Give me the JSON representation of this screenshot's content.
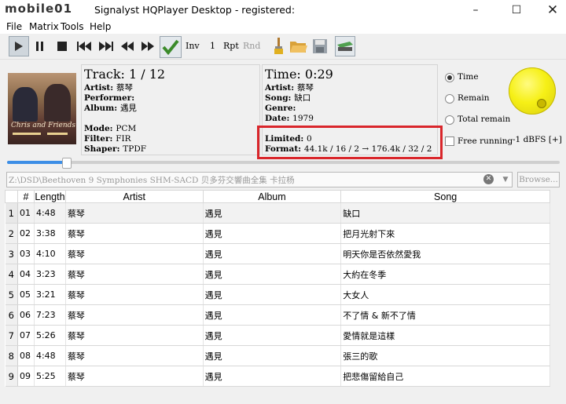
{
  "window": {
    "logo": "mobile01",
    "title": "Signalyst HQPlayer Desktop - registered:"
  },
  "menu": [
    "File",
    "Matrix",
    "Tools",
    "Help"
  ],
  "toolbar": {
    "inv": "Inv",
    "one": "1",
    "rpt": "Rpt",
    "rnd": "Rnd"
  },
  "album_art": {
    "caption": "Chris and Friends"
  },
  "track": {
    "header": "Track: 1 / 12",
    "artist_label": "Artist:",
    "artist": "蔡琴",
    "performer_label": "Performer:",
    "performer": "",
    "album_label": "Album:",
    "album": "遇見",
    "mode_label": "Mode:",
    "mode": "PCM",
    "filter_label": "Filter:",
    "filter": "FIR",
    "shaper_label": "Shaper:",
    "shaper": "TPDF"
  },
  "time": {
    "header": "Time: 0:29",
    "artist_label": "Artist:",
    "artist": "蔡琴",
    "song_label": "Song:",
    "song": "缺口",
    "genre_label": "Genre:",
    "genre": "",
    "date_label": "Date:",
    "date": "1979",
    "limited_label": "Limited:",
    "limited": "0",
    "format_label": "Format:",
    "format": "44.1k / 16 / 2 → 176.4k / 32 / 2"
  },
  "options": {
    "time": "Time",
    "remain": "Remain",
    "total_remain": "Total remain",
    "free_running": "Free running",
    "volume": "-1 dBFS [+]"
  },
  "accent": {
    "highlight": "#d9262b",
    "slider": "#3d8ee6",
    "knob": "#f6f016"
  },
  "path": "Z:\\DSD\\Beethoven 9 Symphonies SHM-SACD 贝多芬交響曲全集 卡拉杨",
  "browse": "Browse...",
  "playlist": {
    "headers": [
      "#",
      "Length",
      "Artist",
      "Album",
      "Song"
    ],
    "rows": [
      {
        "idx": "1",
        "num": "01",
        "length": "4:48",
        "artist": "蔡琴",
        "album": "遇見",
        "song": "缺口"
      },
      {
        "idx": "2",
        "num": "02",
        "length": "3:38",
        "artist": "蔡琴",
        "album": "遇見",
        "song": "把月光射下來"
      },
      {
        "idx": "3",
        "num": "03",
        "length": "4:10",
        "artist": "蔡琴",
        "album": "遇見",
        "song": "明天你是否依然愛我"
      },
      {
        "idx": "4",
        "num": "04",
        "length": "3:23",
        "artist": "蔡琴",
        "album": "遇見",
        "song": "大約在冬季"
      },
      {
        "idx": "5",
        "num": "05",
        "length": "3:21",
        "artist": "蔡琴",
        "album": "遇見",
        "song": "大女人"
      },
      {
        "idx": "6",
        "num": "06",
        "length": "7:23",
        "artist": "蔡琴",
        "album": "遇見",
        "song": "不了情 & 新不了情"
      },
      {
        "idx": "7",
        "num": "07",
        "length": "5:26",
        "artist": "蔡琴",
        "album": "遇見",
        "song": "愛情就是這樣"
      },
      {
        "idx": "8",
        "num": "08",
        "length": "4:48",
        "artist": "蔡琴",
        "album": "遇見",
        "song": "張三的歌"
      },
      {
        "idx": "9",
        "num": "09",
        "length": "5:25",
        "artist": "蔡琴",
        "album": "遇見",
        "song": "把悲傷留給自己"
      }
    ]
  }
}
